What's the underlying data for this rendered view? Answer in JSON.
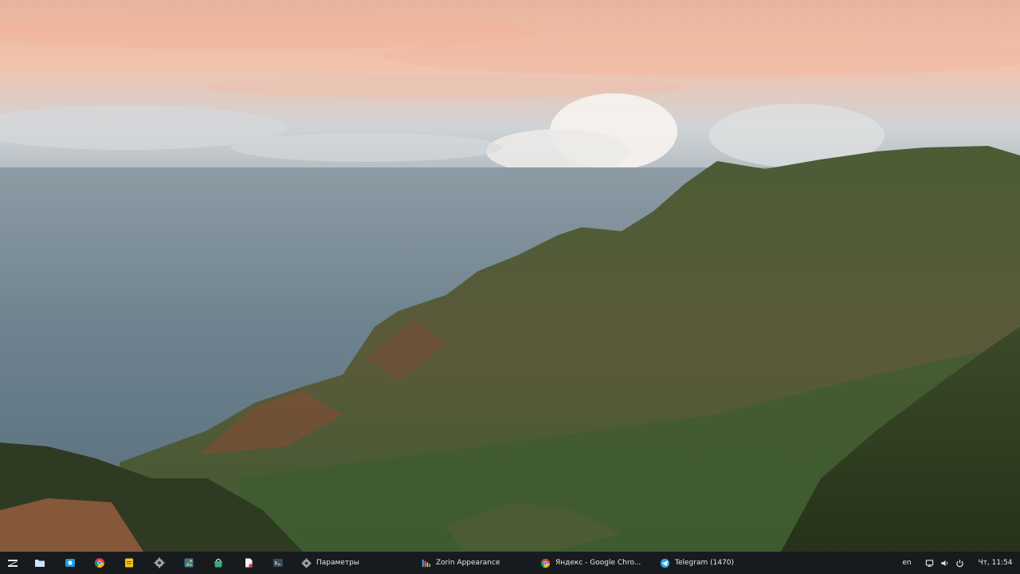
{
  "desktop": {
    "wallpaper": "kalalau-valley-coastline"
  },
  "taskbar": {
    "pinned": [
      {
        "name": "zorin-menu-icon",
        "color": "#4aa3ff"
      },
      {
        "name": "files-icon",
        "color": "#b9d7ff"
      },
      {
        "name": "screenshot-icon",
        "color": "#1e9be3"
      },
      {
        "name": "chrome-icon",
        "color": "#db4437"
      },
      {
        "name": "notes-icon",
        "color": "#f5c518"
      },
      {
        "name": "settings-gear-icon",
        "color": "#9aa5b1"
      },
      {
        "name": "image-viewer-icon",
        "color": "#5cc08a"
      },
      {
        "name": "software-store-icon",
        "color": "#2fb37b"
      },
      {
        "name": "document-viewer-icon",
        "color": "#e23b3b"
      },
      {
        "name": "terminal-icon",
        "color": "#3c4a56"
      }
    ],
    "tasks": [
      {
        "label": "Параметры",
        "icon": "settings-gear-icon"
      },
      {
        "label": "Zorin Appearance",
        "icon": "zorin-appearance-icon"
      },
      {
        "label": "Яндекс - Google Chro...",
        "icon": "chrome-icon"
      },
      {
        "label": "Telegram (1470)",
        "icon": "telegram-icon"
      }
    ],
    "tray": {
      "language": "en",
      "clock": "Чт, 11:54"
    }
  }
}
